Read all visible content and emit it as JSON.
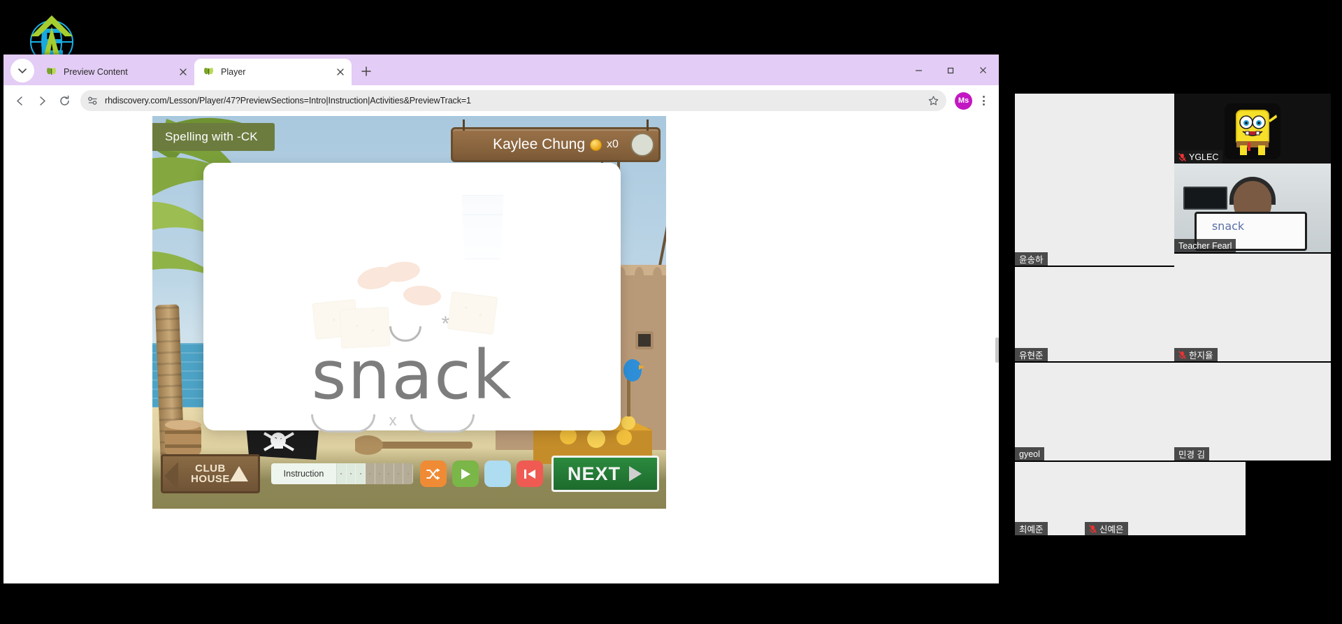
{
  "browser": {
    "window_controls": {
      "minimize": "minimize-button",
      "maximize": "maximize-button",
      "close": "close-button"
    },
    "tabs": [
      {
        "title": "Preview Content",
        "active": false,
        "favicon": "butterfly-icon"
      },
      {
        "title": "Player",
        "active": true,
        "favicon": "butterfly-icon"
      }
    ],
    "newtab_label": "+",
    "nav": {
      "back": "back-icon",
      "forward": "forward-icon",
      "reload": "reload-icon"
    },
    "omnibox": {
      "site_icon": "site-settings-icon",
      "url": "rhdiscovery.com/Lesson/Player/47?PreviewSections=Intro|Instruction|Activities&PreviewTrack=1",
      "bookmark_icon": "star-icon"
    },
    "profile": {
      "initials": "Ms",
      "color": "#c217c2"
    },
    "menu_icon": "kebab-menu-icon"
  },
  "lesson": {
    "title": "Spelling with -CK",
    "student": {
      "name": "Kaylee Chung",
      "coin_icon": "coin-icon",
      "coin_count": "x0"
    },
    "card": {
      "word": "snack",
      "illustration": "crackers-nuts-and-milk-illustration",
      "marks": {
        "breve": "breve-over-a",
        "star": "*",
        "cross": "x"
      }
    },
    "toolbar": {
      "clubhouse_line1": "CLUB",
      "clubhouse_line2": "HOUSE",
      "progress_label": "Instruction",
      "progress_segments": 8,
      "progress_done": 3,
      "buttons": [
        {
          "name": "shuffle-button",
          "icon": "shuffle-icon",
          "color": "#f08b35"
        },
        {
          "name": "play-button",
          "icon": "play-icon",
          "color": "#7ab648"
        },
        {
          "name": "blank-button",
          "icon": "blank-icon",
          "color": "#aedcf0"
        },
        {
          "name": "rewind-button",
          "icon": "rewind-icon",
          "color": "#ef5b52"
        }
      ],
      "next_label": "NEXT"
    }
  },
  "video_panel": {
    "participants": [
      {
        "name": "윤송하",
        "muted": false,
        "speaking": false,
        "video": "blank"
      },
      {
        "name": "YGLEC",
        "muted": true,
        "speaking": false,
        "video": "spongebob-avatar"
      },
      {
        "name": "유현준",
        "muted": false,
        "speaking": false,
        "video": "blank"
      },
      {
        "name": "Teacher Fearl",
        "muted": false,
        "speaking": true,
        "video": "teacher-whiteboard",
        "whiteboard_word": "snack"
      },
      {
        "name": "gyeol",
        "muted": false,
        "speaking": false,
        "video": "blank"
      },
      {
        "name": "한지율",
        "muted": true,
        "speaking": false,
        "video": "blank"
      },
      {
        "name": "최예준",
        "muted": false,
        "speaking": false,
        "video": "blank"
      },
      {
        "name": "민경 김",
        "muted": false,
        "speaking": false,
        "video": "blank"
      },
      {
        "name": "신예은",
        "muted": true,
        "speaking": false,
        "video": "blank"
      }
    ]
  },
  "desktop": {
    "logo": "green-arrow-e-globe-logo"
  }
}
